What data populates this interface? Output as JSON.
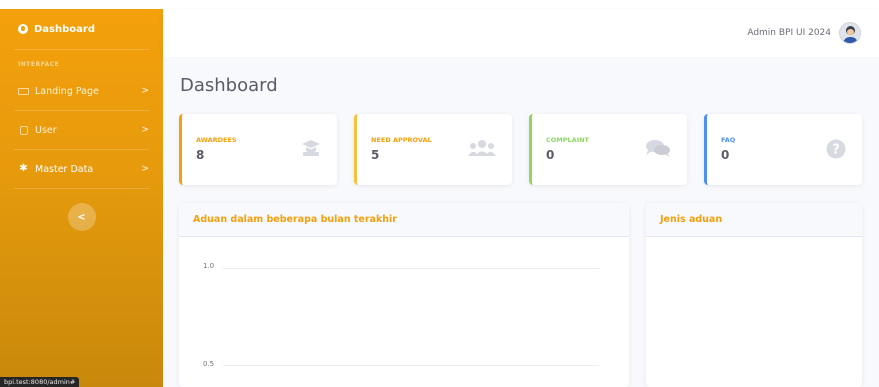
{
  "sidebar": {
    "brand": "Dashboard",
    "heading": "INTERFACE",
    "items": [
      {
        "label": "Landing Page",
        "icon": "card-icon",
        "chevron": ">"
      },
      {
        "label": "User",
        "icon": "user-icon",
        "chevron": ">"
      },
      {
        "label": "Master Data",
        "icon": "gear-icon",
        "chevron": ">"
      }
    ],
    "toggle": "<",
    "accent": "#f4a00c"
  },
  "topbar": {
    "user_name": "Admin BPI UI 2024"
  },
  "main": {
    "title": "Dashboard"
  },
  "cards": [
    {
      "label": "AWARDEES",
      "value": "8",
      "color": "#f4a00c",
      "icon": "graduation-icon"
    },
    {
      "label": "NEED APPROVAL",
      "value": "5",
      "color": "#f6c23e",
      "icon": "users-icon"
    },
    {
      "label": "COMPLAINT",
      "value": "0",
      "color": "#8ed862",
      "icon": "comments-icon"
    },
    {
      "label": "FAQ",
      "value": "0",
      "color": "#4e8ff2",
      "icon": "question-icon"
    }
  ],
  "panels": {
    "area": {
      "title": "Aduan dalam beberapa bulan terakhir",
      "ticks": [
        "1.0",
        "0.5"
      ]
    },
    "pie": {
      "title": "Jenis aduan"
    }
  },
  "status_url": "bpi.test:8080/admin#"
}
